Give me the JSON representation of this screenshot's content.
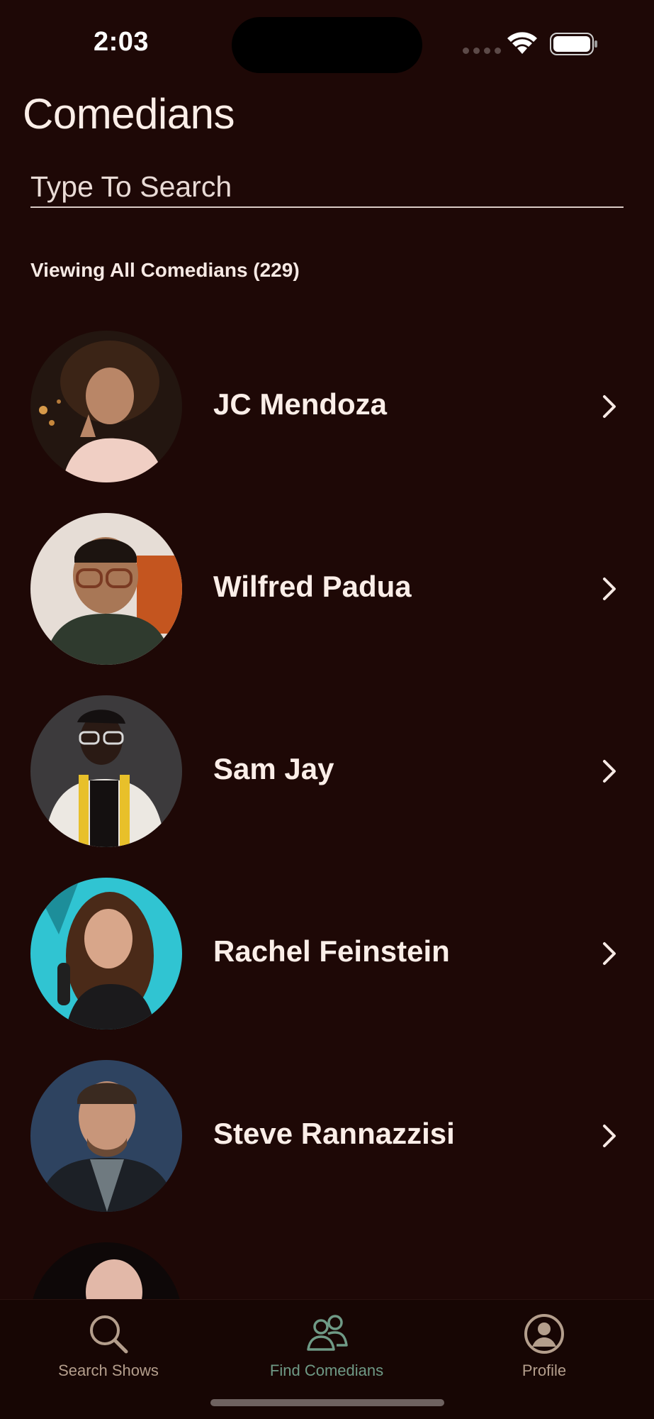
{
  "status_bar": {
    "time": "2:03"
  },
  "header": {
    "title": "Comedians",
    "search_placeholder": "Type To Search",
    "viewing_label": "Viewing All Comedians (229)"
  },
  "comedians": [
    {
      "name": "JC Mendoza"
    },
    {
      "name": "Wilfred Padua"
    },
    {
      "name": "Sam Jay"
    },
    {
      "name": "Rachel Feinstein"
    },
    {
      "name": "Steve Rannazzisi"
    },
    {
      "name": ""
    }
  ],
  "tab_bar": {
    "tabs": [
      {
        "label": "Search Shows",
        "icon": "search-icon",
        "active": false
      },
      {
        "label": "Find Comedians",
        "icon": "people-icon",
        "active": true
      },
      {
        "label": "Profile",
        "icon": "person-circle-icon",
        "active": false
      }
    ]
  },
  "colors": {
    "background": "#1e0806",
    "tab_bar_background": "#170604",
    "active_tab": "#6f9a86",
    "inactive_tab": "#b49e8c"
  }
}
